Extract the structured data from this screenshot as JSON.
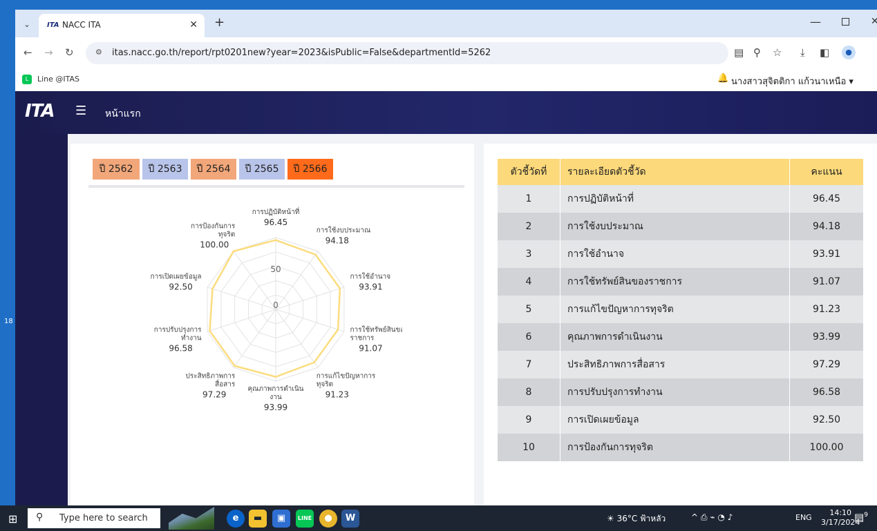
{
  "browser": {
    "tab_title": "NACC ITA",
    "tab_favicon": "ITA",
    "url": "itas.nacc.go.th/report/rpt0201new?year=2023&isPublic=False&departmentId=5262",
    "bookmark_label": "Line @ITAS",
    "icons": [
      "chevron-down-icon",
      "close-icon",
      "plus-icon",
      "back-icon",
      "forward-icon",
      "reload-icon",
      "site-info-icon",
      "translate-icon",
      "zoom-icon",
      "star-icon",
      "download-icon",
      "sidepanel-icon",
      "profile-icon",
      "minimize-icon",
      "maximize-icon"
    ]
  },
  "header": {
    "logo": "ITA",
    "home_label": "หน้าแรก",
    "user_name": "นางสาวสุจิตติกา แก้วนาเหนือ",
    "user_caret": "▾"
  },
  "years": [
    {
      "label": "ปี 2562",
      "color": "#f2a77a"
    },
    {
      "label": "ปี 2563",
      "color": "#b9c4ea"
    },
    {
      "label": "ปี 2564",
      "color": "#f2a77a"
    },
    {
      "label": "ปี 2565",
      "color": "#b9c4ea"
    },
    {
      "label": "ปี 2566",
      "color": "#ff6b1a"
    }
  ],
  "chart_data": {
    "type": "radar",
    "range": [
      0,
      100
    ],
    "tick_labels": [
      "0",
      "50"
    ],
    "line_color": "#fbdc7e",
    "axes": [
      {
        "label_lines": [
          "การปฏิบัติหน้าที่"
        ],
        "value": 96.45,
        "value_text": "96.45"
      },
      {
        "label_lines": [
          "การใช้งบประมาณ"
        ],
        "value": 94.18,
        "value_text": "94.18"
      },
      {
        "label_lines": [
          "การใช้อำนาจ"
        ],
        "value": 93.91,
        "value_text": "93.91"
      },
      {
        "label_lines": [
          "การใช้ทรัพย์สินของ",
          "ราชการ"
        ],
        "value": 91.07,
        "value_text": "91.07"
      },
      {
        "label_lines": [
          "การแก้ไขปัญหาการ",
          "ทุจริต"
        ],
        "value": 91.23,
        "value_text": "91.23"
      },
      {
        "label_lines": [
          "คุณภาพการดำเนิน",
          "งาน"
        ],
        "value": 93.99,
        "value_text": "93.99"
      },
      {
        "label_lines": [
          "ประสิทธิภาพการ",
          "สื่อสาร"
        ],
        "value": 97.29,
        "value_text": "97.29"
      },
      {
        "label_lines": [
          "การปรับปรุงการ",
          "ทำงาน"
        ],
        "value": 96.58,
        "value_text": "96.58"
      },
      {
        "label_lines": [
          "การเปิดเผยข้อมูล"
        ],
        "value": 92.5,
        "value_text": "92.50"
      },
      {
        "label_lines": [
          "การป้องกันการ",
          "ทุจริต"
        ],
        "value": 100.0,
        "value_text": "100.00"
      }
    ]
  },
  "table": {
    "headers": [
      "ตัวชี้วัดที่",
      "รายละเอียดตัวชี้วัด",
      "คะแนน"
    ],
    "rows": [
      [
        "1",
        "การปฏิบัติหน้าที่",
        "96.45"
      ],
      [
        "2",
        "การใช้งบประมาณ",
        "94.18"
      ],
      [
        "3",
        "การใช้อำนาจ",
        "93.91"
      ],
      [
        "4",
        "การใช้ทรัพย์สินของราชการ",
        "91.07"
      ],
      [
        "5",
        "การแก้ไขปัญหาการทุจริต",
        "91.23"
      ],
      [
        "6",
        "คุณภาพการดำเนินงาน",
        "93.99"
      ],
      [
        "7",
        "ประสิทธิภาพการสื่อสาร",
        "97.29"
      ],
      [
        "8",
        "การปรับปรุงการทำงาน",
        "96.58"
      ],
      [
        "9",
        "การเปิดเผยข้อมูล",
        "92.50"
      ],
      [
        "10",
        "การป้องกันการทุจริต",
        "100.00"
      ]
    ]
  },
  "taskbar": {
    "search_placeholder": "Type here to search",
    "weather": "36°C ฟ้าหลัว",
    "lang": "ENG",
    "time": "14:10",
    "date": "3/17/2024",
    "notif_count": "9",
    "left_edge_text": "18"
  }
}
